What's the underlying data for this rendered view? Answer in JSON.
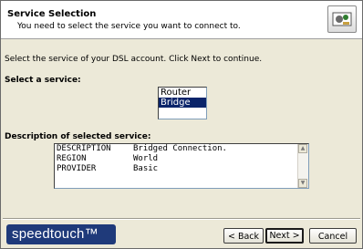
{
  "header": {
    "title": "Service Selection",
    "subtitle": "You need to select the service you want to connect to."
  },
  "instruction": "Select the service of your DSL account. Click Next to continue.",
  "service_section": {
    "label": "Select a service:",
    "options": [
      "Router",
      "Bridge"
    ],
    "selected": "Bridge"
  },
  "description_section": {
    "label": "Description of selected service:",
    "rows": [
      {
        "key": "DESCRIPTION",
        "value": "Bridged Connection."
      },
      {
        "key": "REGION",
        "value": "World"
      },
      {
        "key": "PROVIDER",
        "value": "Basic"
      }
    ]
  },
  "brand": {
    "logo_text": "speedtouch™",
    "color": "#1f3a7a"
  },
  "buttons": {
    "back": "< Back",
    "next": "Next >",
    "cancel": "Cancel"
  },
  "colors": {
    "selection": "#0a246a",
    "window_bg": "#ece9d8"
  }
}
